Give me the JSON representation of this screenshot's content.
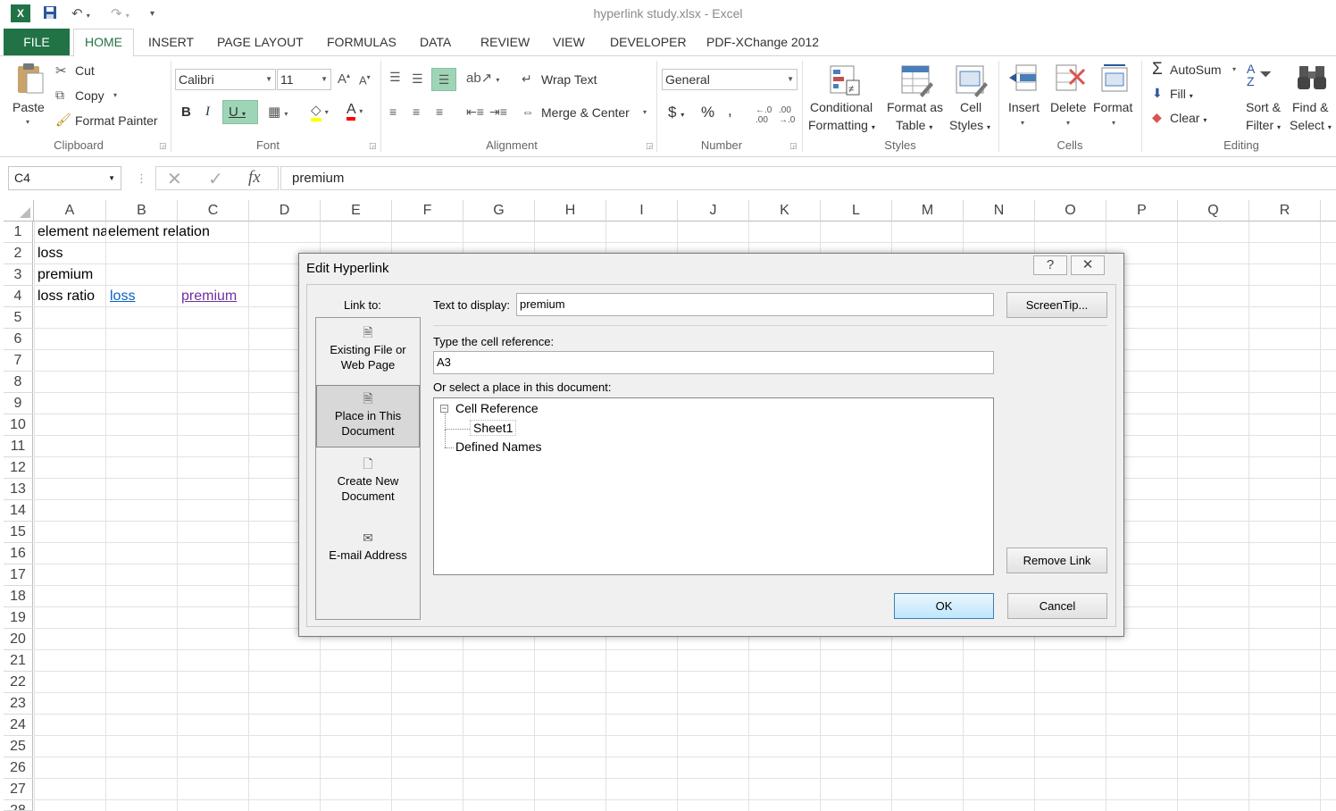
{
  "window": {
    "title": "hyperlink study.xlsx - Excel"
  },
  "tabs": {
    "file": "FILE",
    "home": "HOME",
    "insert": "INSERT",
    "page_layout": "PAGE LAYOUT",
    "formulas": "FORMULAS",
    "data": "DATA",
    "review": "REVIEW",
    "view": "VIEW",
    "developer": "DEVELOPER",
    "pdfx": "PDF-XChange 2012"
  },
  "ribbon": {
    "clipboard": {
      "paste": "Paste",
      "cut": "Cut",
      "copy": "Copy",
      "format_painter": "Format Painter",
      "label": "Clipboard"
    },
    "font": {
      "name": "Calibri",
      "size": "11",
      "label": "Font"
    },
    "alignment": {
      "wrap_text": "Wrap Text",
      "merge_center": "Merge & Center",
      "label": "Alignment"
    },
    "number": {
      "format": "General",
      "label": "Number"
    },
    "styles": {
      "conditional_1": "Conditional",
      "conditional_2": "Formatting",
      "format_as_1": "Format as",
      "format_as_2": "Table",
      "cell_styles_1": "Cell",
      "cell_styles_2": "Styles",
      "label": "Styles"
    },
    "cells": {
      "insert": "Insert",
      "delete": "Delete",
      "format": "Format",
      "label": "Cells"
    },
    "editing": {
      "autosum": "AutoSum",
      "fill": "Fill",
      "clear": "Clear",
      "sort_1": "Sort &",
      "sort_2": "Filter",
      "find_1": "Find &",
      "find_2": "Select",
      "label": "Editing"
    }
  },
  "formula_bar": {
    "name_box": "C4",
    "content": "premium"
  },
  "sheet": {
    "columns": [
      "A",
      "B",
      "C",
      "D",
      "E",
      "F",
      "G",
      "H",
      "I",
      "J",
      "K",
      "L",
      "M",
      "N",
      "O",
      "P",
      "Q",
      "R"
    ],
    "rows": [
      "1",
      "2",
      "3",
      "4",
      "5",
      "6",
      "7",
      "8",
      "9",
      "10",
      "11",
      "12",
      "13",
      "14",
      "15",
      "16",
      "17",
      "18",
      "19",
      "20",
      "21",
      "22",
      "23",
      "24",
      "25",
      "26",
      "27",
      "28"
    ],
    "a1": "element na",
    "b1": "element relation",
    "a2": "loss",
    "a3": "premium",
    "a4": "loss ratio",
    "b4": "loss",
    "c4": "premium"
  },
  "dialog": {
    "title": "Edit Hyperlink",
    "help": "?",
    "link_to": "Link to:",
    "items": {
      "existing_1": "Existing File or",
      "existing_2": "Web Page",
      "place_1": "Place in This",
      "place_2": "Document",
      "create_1": "Create New",
      "create_2": "Document",
      "email": "E-mail Address"
    },
    "text_to_display_label": "Text to display:",
    "text_to_display_value": "premium",
    "screentip": "ScreenTip...",
    "cell_ref_label": "Type the cell reference:",
    "cell_ref_value": "A3",
    "select_place_label": "Or select a place in this document:",
    "tree": {
      "cell_reference": "Cell Reference",
      "sheet1": "Sheet1",
      "defined_names": "Defined Names"
    },
    "remove_link": "Remove Link",
    "ok": "OK",
    "cancel": "Cancel"
  },
  "colors": {
    "excel_green": "#217346",
    "link_blue": "#0563c1",
    "link_visited": "#7030a0"
  }
}
